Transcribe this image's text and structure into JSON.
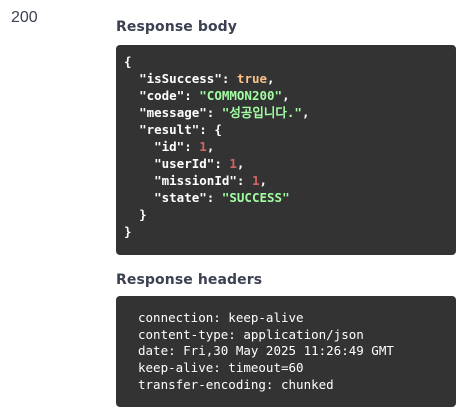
{
  "status": {
    "code": "200"
  },
  "response_body": {
    "title": "Response body",
    "lines": [
      {
        "indent": "",
        "parts": [
          {
            "t": "{",
            "c": "p"
          }
        ]
      },
      {
        "indent": "  ",
        "parts": [
          {
            "t": "\"isSuccess\"",
            "c": "k"
          },
          {
            "t": ": ",
            "c": "p"
          },
          {
            "t": "true",
            "c": "b"
          },
          {
            "t": ",",
            "c": "p"
          }
        ]
      },
      {
        "indent": "  ",
        "parts": [
          {
            "t": "\"code\"",
            "c": "k"
          },
          {
            "t": ": ",
            "c": "p"
          },
          {
            "t": "\"COMMON200\"",
            "c": "s"
          },
          {
            "t": ",",
            "c": "p"
          }
        ]
      },
      {
        "indent": "  ",
        "parts": [
          {
            "t": "\"message\"",
            "c": "k"
          },
          {
            "t": ": ",
            "c": "p"
          },
          {
            "t": "\"성공입니다.\"",
            "c": "s"
          },
          {
            "t": ",",
            "c": "p"
          }
        ]
      },
      {
        "indent": "  ",
        "parts": [
          {
            "t": "\"result\"",
            "c": "k"
          },
          {
            "t": ": {",
            "c": "p"
          }
        ]
      },
      {
        "indent": "    ",
        "parts": [
          {
            "t": "\"id\"",
            "c": "k"
          },
          {
            "t": ": ",
            "c": "p"
          },
          {
            "t": "1",
            "c": "n"
          },
          {
            "t": ",",
            "c": "p"
          }
        ]
      },
      {
        "indent": "    ",
        "parts": [
          {
            "t": "\"userId\"",
            "c": "k"
          },
          {
            "t": ": ",
            "c": "p"
          },
          {
            "t": "1",
            "c": "n"
          },
          {
            "t": ",",
            "c": "p"
          }
        ]
      },
      {
        "indent": "    ",
        "parts": [
          {
            "t": "\"missionId\"",
            "c": "k"
          },
          {
            "t": ": ",
            "c": "p"
          },
          {
            "t": "1",
            "c": "n"
          },
          {
            "t": ",",
            "c": "p"
          }
        ]
      },
      {
        "indent": "    ",
        "parts": [
          {
            "t": "\"state\"",
            "c": "k"
          },
          {
            "t": ": ",
            "c": "p"
          },
          {
            "t": "\"SUCCESS\"",
            "c": "s"
          }
        ]
      },
      {
        "indent": "  ",
        "parts": [
          {
            "t": "}",
            "c": "p"
          }
        ]
      },
      {
        "indent": "",
        "parts": [
          {
            "t": "}",
            "c": "p"
          }
        ]
      }
    ]
  },
  "response_headers": {
    "title": "Response headers",
    "lines": [
      "connection: keep-alive",
      "content-type: application/json",
      "date: Fri,30 May 2025 11:26:49 GMT",
      "keep-alive: timeout=60",
      "transfer-encoding: chunked"
    ]
  },
  "colors": {
    "code_background": "#333333",
    "string": "#a2fca2",
    "number": "#d36363",
    "boolean": "#fcc28c",
    "title_text": "#3b4151"
  }
}
